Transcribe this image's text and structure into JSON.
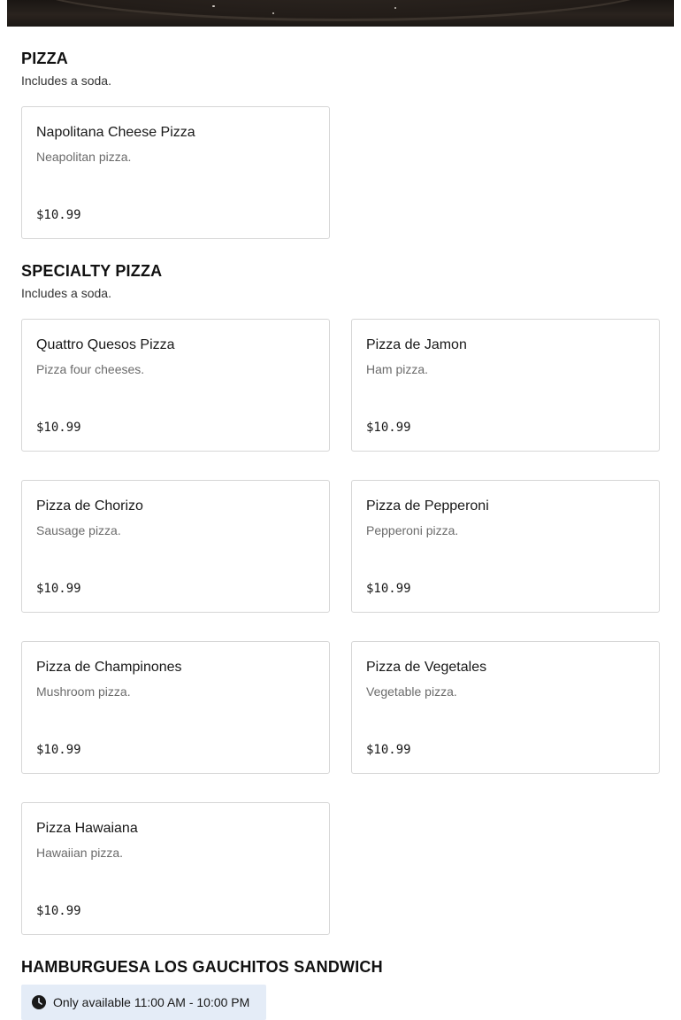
{
  "hero": {
    "image_alt": "food plate photo"
  },
  "sections": [
    {
      "title": "PIZZA",
      "subtitle": "Includes a soda.",
      "items": [
        {
          "name": "Napolitana Cheese Pizza",
          "description": "Neapolitan pizza.",
          "price": "$10.99"
        }
      ]
    },
    {
      "title": "SPECIALTY PIZZA",
      "subtitle": "Includes a soda.",
      "items": [
        {
          "name": "Quattro Quesos Pizza",
          "description": "Pizza four cheeses.",
          "price": "$10.99"
        },
        {
          "name": "Pizza de Jamon",
          "description": "Ham pizza.",
          "price": "$10.99"
        },
        {
          "name": "Pizza de Chorizo",
          "description": "Sausage pizza.",
          "price": "$10.99"
        },
        {
          "name": "Pizza de Pepperoni",
          "description": "Pepperoni pizza.",
          "price": "$10.99"
        },
        {
          "name": "Pizza de Champinones",
          "description": "Mushroom pizza.",
          "price": "$10.99"
        },
        {
          "name": "Pizza de Vegetales",
          "description": "Vegetable pizza.",
          "price": "$10.99"
        },
        {
          "name": "Pizza Hawaiana",
          "description": "Hawaiian pizza.",
          "price": "$10.99"
        }
      ]
    },
    {
      "title": "HAMBURGUESA LOS GAUCHITOS SANDWICH",
      "availability": "Only available 11:00 AM - 10:00 PM",
      "availability_icon": "clock-icon"
    }
  ],
  "colors": {
    "availability_bg": "#e4ecf7",
    "card_border": "#d6d6d6",
    "description_text": "#6b6b6b"
  }
}
